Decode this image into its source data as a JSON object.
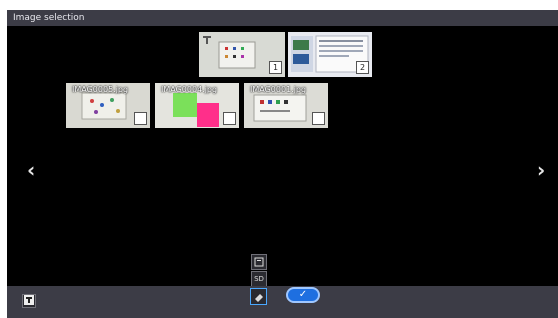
{
  "window": {
    "title": "Image selection"
  },
  "top_row": [
    {
      "badge": "1"
    },
    {
      "badge": "2"
    }
  ],
  "second_row": [
    {
      "filename": "IMAG0005.jpg"
    },
    {
      "filename": "IMAG0004.jpg"
    },
    {
      "filename": "IMAG0001.jpg"
    }
  ],
  "nav": {
    "prev": "‹",
    "next": "›"
  },
  "toolbar": {
    "storage_label": "SD",
    "confirm_glyph": "✓"
  },
  "icons": [
    "text-tool-icon",
    "page-icon",
    "sd-card-icon",
    "eraser-icon",
    "check-icon",
    "chevron-left-icon",
    "chevron-right-icon"
  ]
}
